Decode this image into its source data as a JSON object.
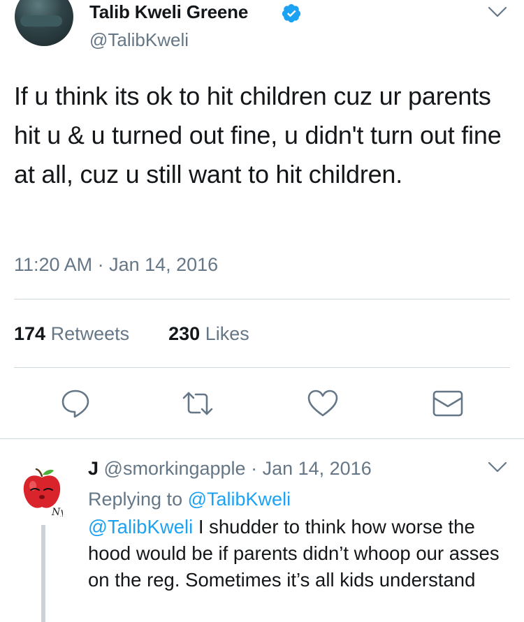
{
  "tweet": {
    "author_name": "Talib Kweli Greene",
    "author_handle": "@TalibKweli",
    "text": "If u think its ok to hit children cuz ur parents hit u & u turned out fine, u didn't turn out fine at all, cuz u still want to hit children.",
    "timestamp": "11:20 AM · Jan 14, 2016",
    "retweets_count": "174",
    "retweets_label": "Retweets",
    "likes_count": "230",
    "likes_label": "Likes"
  },
  "reply": {
    "name": "J",
    "handle": "@smorkingapple",
    "date": "· Jan 14, 2016",
    "replying_prefix": "Replying to",
    "replying_to": "@TalibKweli",
    "mention": "@TalibKweli",
    "text": " I shudder to think how worse the hood would be if parents didn’t whoop our asses on the reg. Sometimes it’s all kids understand"
  },
  "icons": {
    "verified": "verified-badge-icon",
    "reply": "reply-icon",
    "retweet": "retweet-icon",
    "like": "heart-icon",
    "dm": "envelope-icon",
    "caret": "chevron-down-icon"
  },
  "colors": {
    "accent": "#1da1f2",
    "secondary_text": "#657786",
    "icon": "#657786"
  }
}
